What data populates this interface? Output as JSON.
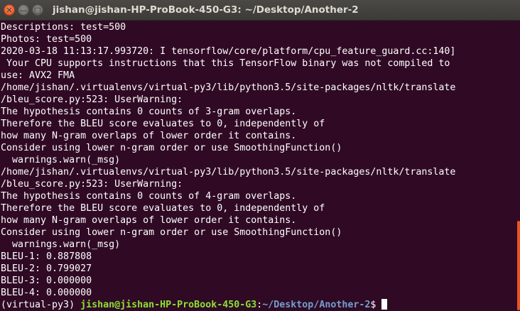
{
  "window": {
    "title": "jishan@jishan-HP-ProBook-450-G3: ~/Desktop/Another-2",
    "close_glyph": "✕",
    "minimize_glyph": "—",
    "maximize_glyph": "□"
  },
  "terminal": {
    "lines": [
      "Descriptions: test=500",
      "Photos: test=500",
      "2020-03-18 11:13:17.993720: I tensorflow/core/platform/cpu_feature_guard.cc:140]",
      " Your CPU supports instructions that this TensorFlow binary was not compiled to",
      "use: AVX2 FMA",
      "/home/jishan/.virtualenvs/virtual-py3/lib/python3.5/site-packages/nltk/translate",
      "/bleu_score.py:523: UserWarning:",
      "The hypothesis contains 0 counts of 3-gram overlaps.",
      "Therefore the BLEU score evaluates to 0, independently of",
      "how many N-gram overlaps of lower order it contains.",
      "Consider using lower n-gram order or use SmoothingFunction()",
      "  warnings.warn(_msg)",
      "/home/jishan/.virtualenvs/virtual-py3/lib/python3.5/site-packages/nltk/translate",
      "/bleu_score.py:523: UserWarning:",
      "The hypothesis contains 0 counts of 4-gram overlaps.",
      "Therefore the BLEU score evaluates to 0, independently of",
      "how many N-gram overlaps of lower order it contains.",
      "Consider using lower n-gram order or use SmoothingFunction()",
      "  warnings.warn(_msg)",
      "BLEU-1: 0.887808",
      "BLEU-2: 0.799027",
      "BLEU-3: 0.000000",
      "BLEU-4: 0.000000"
    ],
    "prompt": {
      "venv": "(virtual-py3) ",
      "user_host": "jishan@jishan-HP-ProBook-450-G3",
      "separator": ":",
      "path": "~/Desktop/Another-2",
      "symbol": "$"
    }
  },
  "colors": {
    "background": "#300a24",
    "text": "#ffffff",
    "prompt_user": "#8ae234",
    "prompt_path": "#729fcf",
    "scrollbar_thumb": "#e95420",
    "close_button": "#df4a16"
  }
}
